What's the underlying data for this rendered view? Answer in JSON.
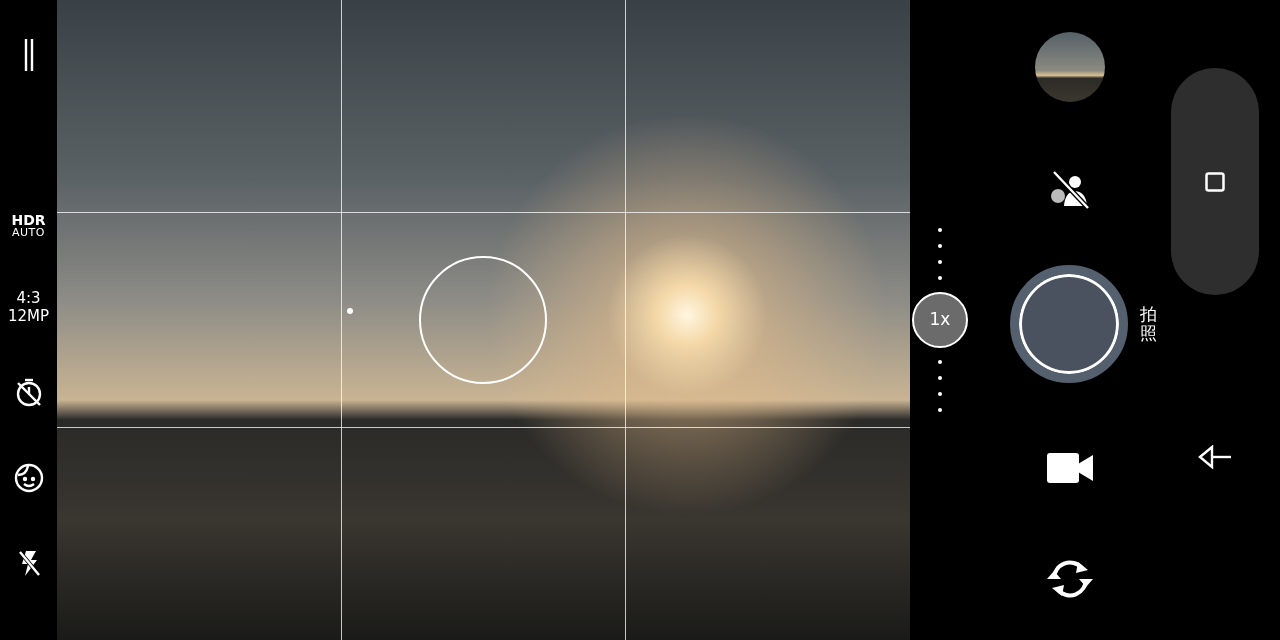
{
  "left_toolbar": {
    "hdr": {
      "label": "HDR",
      "mode": "AUTO"
    },
    "photo_size": {
      "ratio": "4:3",
      "resolution": "12MP"
    }
  },
  "zoom": {
    "label": "1x"
  },
  "shutter": {
    "mode_label": "拍照"
  }
}
